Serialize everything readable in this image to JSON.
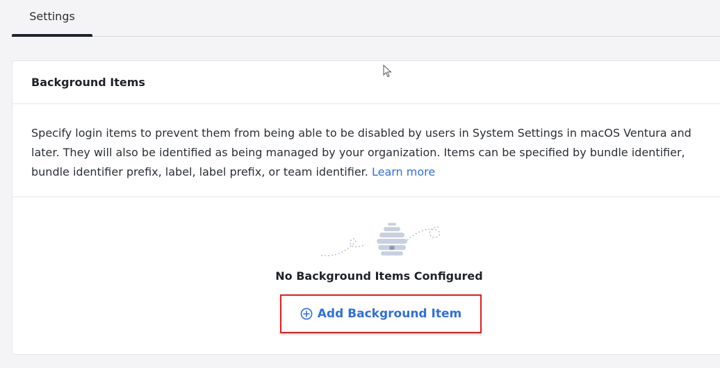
{
  "tabs": [
    {
      "label": "Settings",
      "active": true
    }
  ],
  "card": {
    "title": "Background Items",
    "description": "Specify login items to prevent them from being able to be disabled by users in System Settings in macOS Ventura and later. They will also be identified as being managed by your organization. Items can be specified by bundle identifier, bundle identifier prefix, label, label prefix, or team identifier.",
    "learn_more": "Learn more"
  },
  "empty_state": {
    "illustration": "beehive-icon",
    "title": "No Background Items Configured",
    "add_button": "Add Background Item",
    "add_icon": "plus-circle-icon"
  },
  "colors": {
    "accent": "#2f6fde",
    "highlight_border": "#e01e1e",
    "page_background": "#f4f4f6"
  }
}
